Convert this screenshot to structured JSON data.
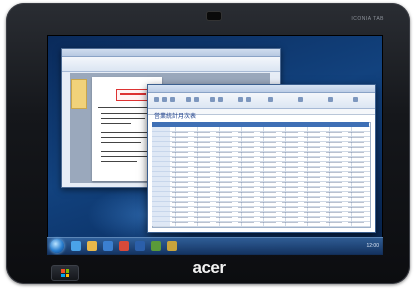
{
  "device": {
    "brand_logo": "acer",
    "model_text": "ICONIA TAB"
  },
  "screen": {
    "excel": {
      "sheet_title": "営業統計月次表"
    },
    "taskbar": {
      "clock": "12:00"
    }
  },
  "colors": {
    "bezel": "#15171b",
    "desktop": "#12427e",
    "excel_header": "#3e6fb5"
  },
  "icons": {
    "start": "windows-start-orb",
    "home_button": "windows-flag"
  }
}
